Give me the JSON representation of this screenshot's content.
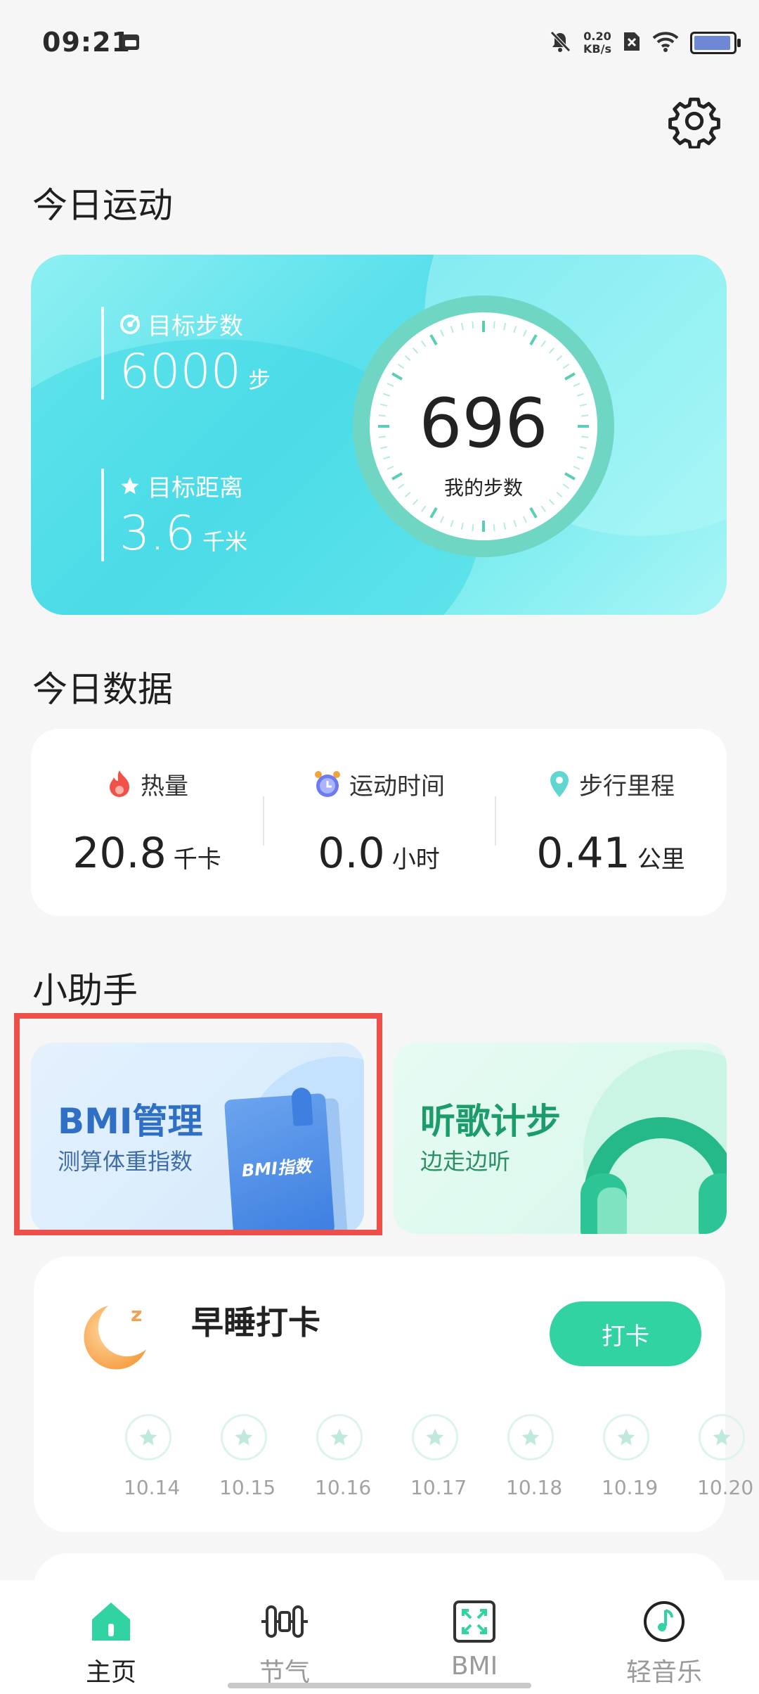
{
  "status_bar": {
    "time": "09:21",
    "net_speed_value": "0.20",
    "net_speed_unit": "KB/s",
    "battery_level": 0.85
  },
  "header": {
    "settings_icon": "gear-icon"
  },
  "today_activity": {
    "title": "今日运动",
    "target_steps": {
      "label": "目标步数",
      "value": "6000",
      "unit": "步"
    },
    "target_distance": {
      "label": "目标距离",
      "value": "3.6",
      "unit": "千米"
    },
    "steps": {
      "value": "696",
      "label": "我的步数"
    }
  },
  "today_data": {
    "title": "今日数据",
    "items": [
      {
        "label": "热量",
        "value": "20.8",
        "unit": "千卡",
        "icon": "flame-icon"
      },
      {
        "label": "运动时间",
        "value": "0.0",
        "unit": "小时",
        "icon": "alarm-clock-icon"
      },
      {
        "label": "步行里程",
        "value": "0.41",
        "unit": "公里",
        "icon": "location-pin-icon"
      }
    ]
  },
  "assistant": {
    "title": "小助手",
    "bmi": {
      "title": "BMI管理",
      "subtitle": "测算体重指数",
      "book_label": "BMI指数"
    },
    "music": {
      "title": "听歌计步",
      "subtitle": "边走边听"
    }
  },
  "sleep_checkin": {
    "title": "早睡打卡",
    "button": "打卡",
    "days": [
      "10.14",
      "10.15",
      "10.16",
      "10.17",
      "10.18",
      "10.19",
      "10.20"
    ]
  },
  "bottom_nav": {
    "items": [
      {
        "label": "主页",
        "icon": "home-icon",
        "active": true
      },
      {
        "label": "节气",
        "icon": "dumbbell-icon",
        "active": false
      },
      {
        "label": "BMI",
        "icon": "expand-frame-icon",
        "active": false
      },
      {
        "label": "轻音乐",
        "icon": "music-note-icon",
        "active": false
      }
    ]
  },
  "colors": {
    "accent": "#31d3a3",
    "highlight": "#ef4f4a",
    "card_cyan": "#59e0eb",
    "bmi_blue": "#2f6fc4",
    "music_green": "#1c9c6a"
  }
}
